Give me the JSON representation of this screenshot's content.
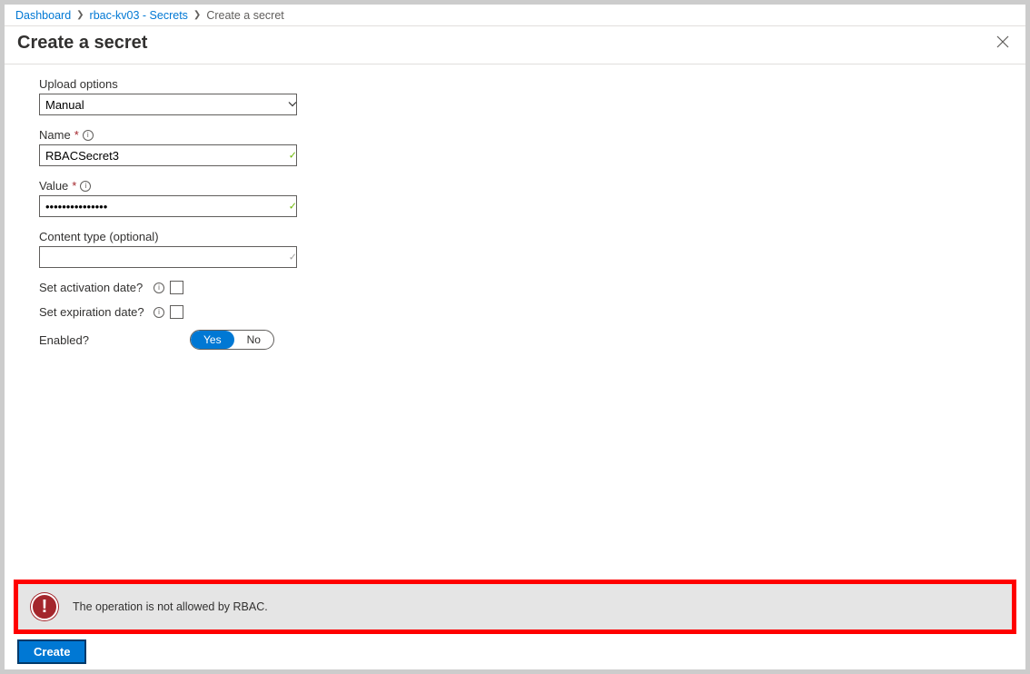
{
  "breadcrumb": {
    "items": [
      {
        "label": "Dashboard",
        "link": true
      },
      {
        "label": "rbac-kv03 - Secrets",
        "link": true
      },
      {
        "label": "Create a secret",
        "link": false
      }
    ]
  },
  "header": {
    "title": "Create a secret"
  },
  "form": {
    "upload_options": {
      "label": "Upload options",
      "value": "Manual"
    },
    "name": {
      "label": "Name",
      "value": "RBACSecret3"
    },
    "value_field": {
      "label": "Value",
      "value": "•••••••••••••••"
    },
    "content_type": {
      "label": "Content type (optional)",
      "value": ""
    },
    "activation": {
      "label": "Set activation date?"
    },
    "expiration": {
      "label": "Set expiration date?"
    },
    "enabled": {
      "label": "Enabled?",
      "yes": "Yes",
      "no": "No"
    }
  },
  "error": {
    "message": "The operation is not allowed by RBAC."
  },
  "buttons": {
    "create": "Create"
  }
}
